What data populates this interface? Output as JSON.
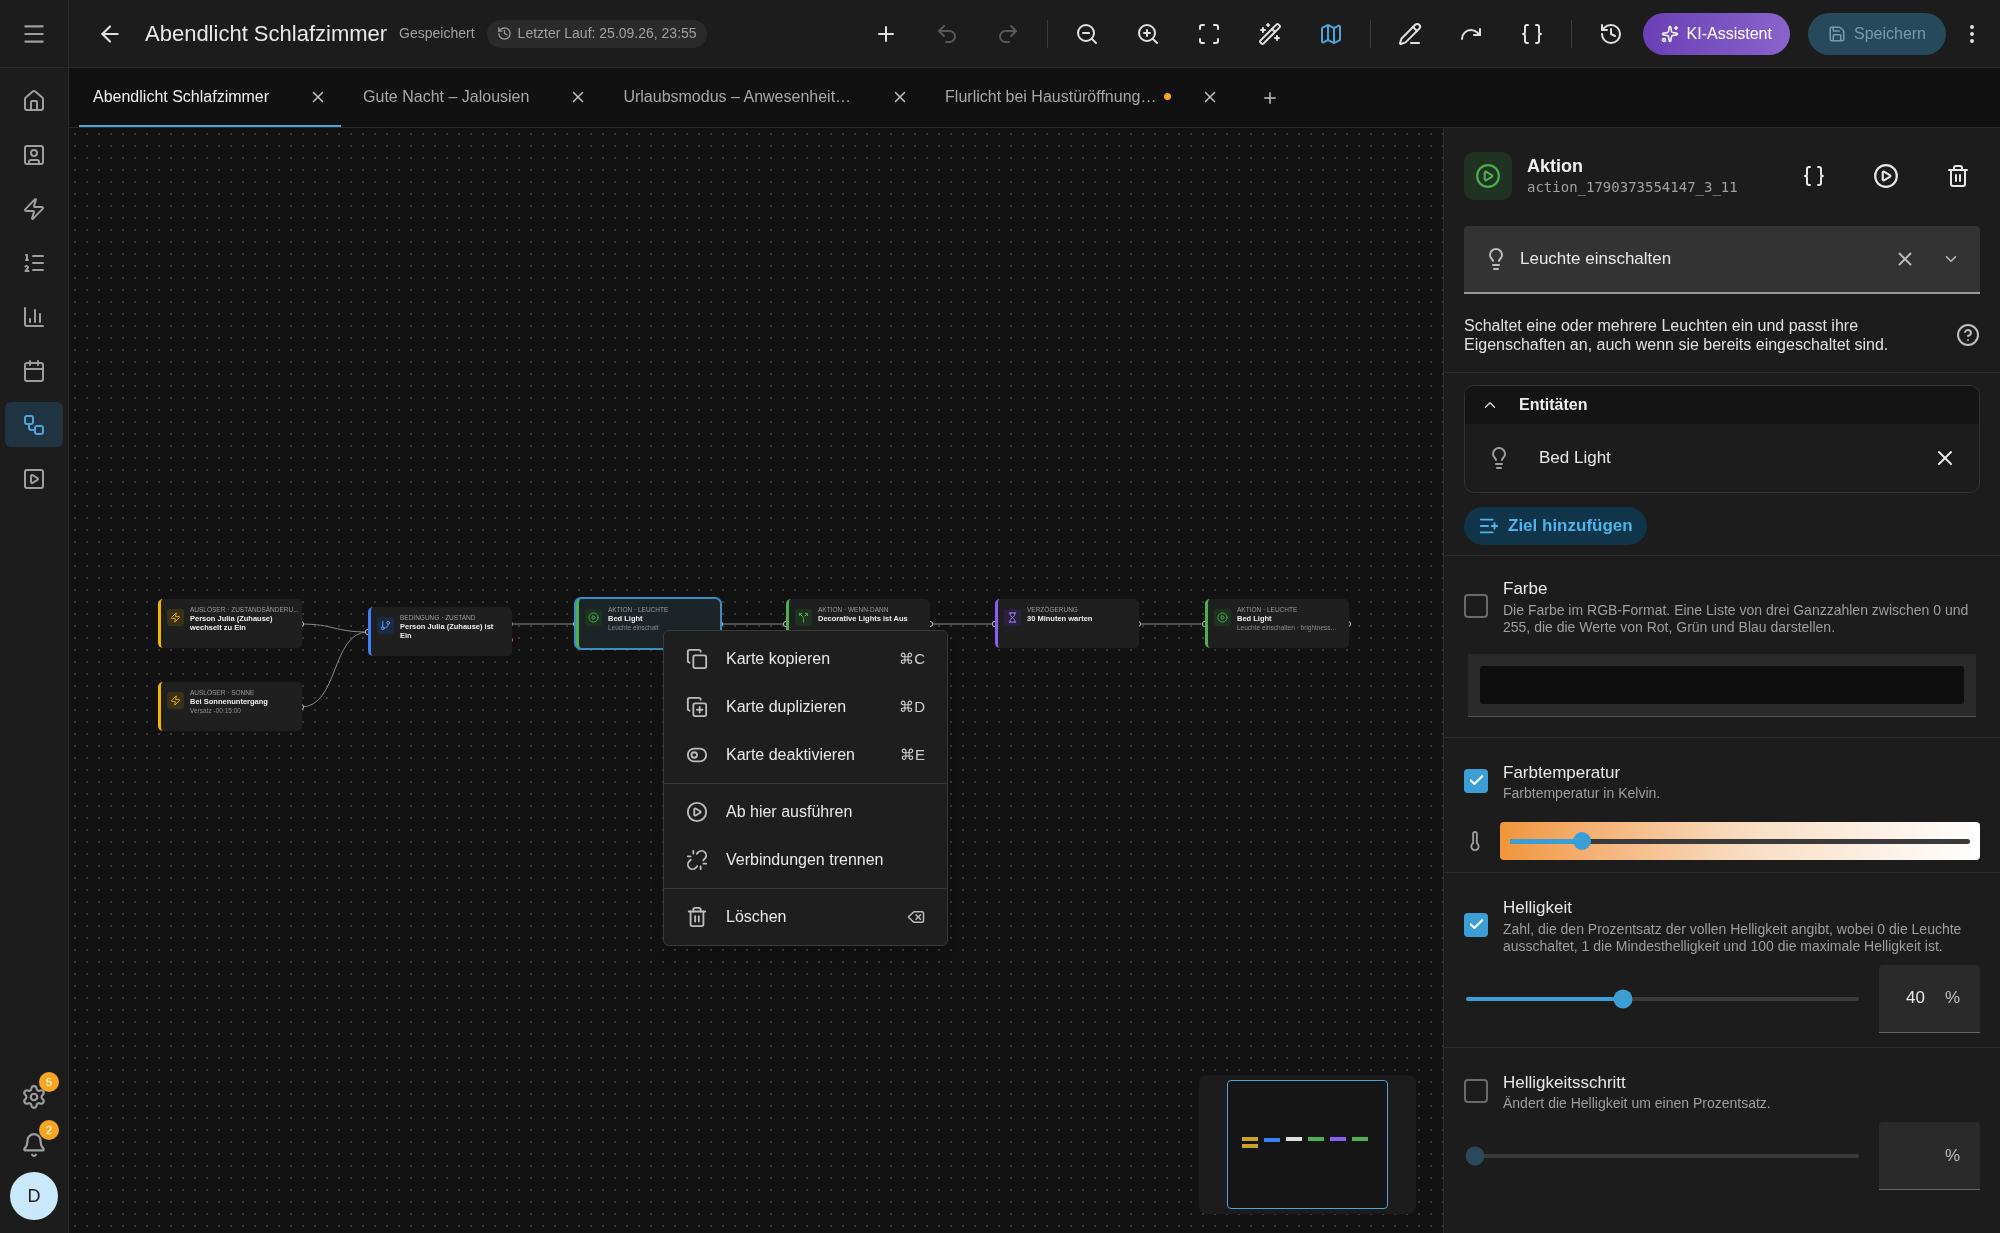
{
  "sidebar": {
    "items": [
      {
        "selected": false
      },
      {
        "selected": false
      },
      {
        "selected": false
      },
      {
        "selected": false
      },
      {
        "selected": false
      },
      {
        "selected": false
      },
      {
        "selected": true
      },
      {
        "selected": false
      }
    ],
    "settings_badge": "5",
    "notifications_badge": "2",
    "avatar": "D"
  },
  "header": {
    "title": "Abendlicht Schlafzimmer",
    "status": "Gespeichert",
    "last_run": "Letzter Lauf: 25.09.26, 23:55",
    "toolbar": [
      {
        "disabled": false,
        "active": false
      },
      {
        "disabled": true,
        "active": false
      },
      {
        "disabled": true,
        "active": false
      },
      {
        "disabled": false,
        "active": false
      },
      {
        "disabled": false,
        "active": false
      },
      {
        "disabled": false,
        "active": false
      },
      {
        "disabled": false,
        "active": false
      },
      {
        "disabled": false,
        "active": true
      },
      {
        "disabled": false,
        "active": false
      },
      {
        "disabled": false,
        "active": false
      },
      {
        "disabled": false,
        "active": false
      },
      {
        "disabled": false,
        "active": false
      }
    ],
    "ai_button": "KI-Assistent",
    "save_button": {
      "label": "Speichern",
      "disabled": true
    }
  },
  "tabs": [
    {
      "label": "Abendlicht Schlafzimmer",
      "selected": true,
      "unsaved": false
    },
    {
      "label": "Gute Nacht – Jalousien",
      "selected": false,
      "unsaved": false
    },
    {
      "label": "Urlaubsmodus – Anwesenheit…",
      "selected": false,
      "unsaved": false
    },
    {
      "label": "Flurlicht bei Haustüröffnung…",
      "selected": false,
      "unsaved": true
    }
  ],
  "canvas": {
    "nodes": [
      {
        "kind": "trigger",
        "category": "AUSLÖSER · ZUSTANDSÄNDERU...",
        "title": "Person Julia (Zuhause) wechselt zu Ein",
        "selected": false
      },
      {
        "kind": "trigger",
        "category": "AUSLÖSER · SONNE",
        "title": "Bei Sonnenuntergang",
        "subtitle": "Versatz -00:15:00",
        "selected": false
      },
      {
        "kind": "condition",
        "category": "BEDINGUNG · ZUSTAND",
        "title": "Person Julia (Zuhause) ist Ein",
        "selected": false
      },
      {
        "kind": "action",
        "category": "AKTION · LEUCHTE",
        "title": "Bed Light",
        "subtitle": "Leuchte einschalt",
        "selected": true
      },
      {
        "kind": "choose",
        "category": "AKTION · WENN-DANN",
        "title": "Decorative Lights ist Aus",
        "selected": false
      },
      {
        "kind": "delay",
        "category": "VERZÖGERUNG",
        "title": "30 Minuten warten",
        "selected": false
      },
      {
        "kind": "action",
        "category": "AKTION · LEUCHTE",
        "title": "Bed Light",
        "subtitle": "Leuchte einschalten · brightness...",
        "selected": false
      }
    ],
    "context_menu": {
      "groups": [
        [
          {
            "label": "Karte kopieren",
            "shortcut": "⌘C"
          },
          {
            "label": "Karte duplizieren",
            "shortcut": "⌘D"
          },
          {
            "label": "Karte deaktivieren",
            "shortcut": "⌘E"
          }
        ],
        [
          {
            "label": "Ab hier ausführen"
          },
          {
            "label": "Verbindungen trennen"
          }
        ],
        [
          {
            "label": "Löschen"
          }
        ]
      ]
    }
  },
  "panel": {
    "title": "Aktion",
    "id": "action_1790373554147_3_11",
    "action_select": "Leuchte einschalten",
    "description": "Schaltet eine oder mehrere Leuchten ein und passt ihre Eigenschaften an, auch wenn sie bereits eingeschaltet sind.",
    "entities": {
      "title": "Entitäten",
      "expanded": true,
      "items": [
        "Bed Light"
      ]
    },
    "add_target": "Ziel hinzufügen",
    "fields": [
      {
        "kind": "color",
        "name": "Farbe",
        "description": "Die Farbe im RGB-Format. Eine Liste von drei Ganzzahlen zwischen 0 und 255, die die Werte von Rot, Grün und Blau darstellen.",
        "checked": false
      },
      {
        "kind": "color_temp",
        "name": "Farbtemperatur",
        "description": "Farbtemperatur in Kelvin.",
        "checked": true,
        "level": 0.156
      },
      {
        "kind": "number",
        "name": "Helligkeit",
        "description": "Zahl, die den Prozentsatz der vollen Helligkeit angibt, wobei 0 die Leuchte ausschaltet, 1 die Mindesthelligkeit und 100 die maximale Helligkeit ist.",
        "checked": true,
        "level": 0.4,
        "value": "40",
        "unit": "%"
      },
      {
        "kind": "number",
        "name": "Helligkeitsschritt",
        "description": "Ändert die Helligkeit um einen Prozentsatz.",
        "checked": false,
        "level": 0,
        "unit": "%"
      }
    ]
  }
}
